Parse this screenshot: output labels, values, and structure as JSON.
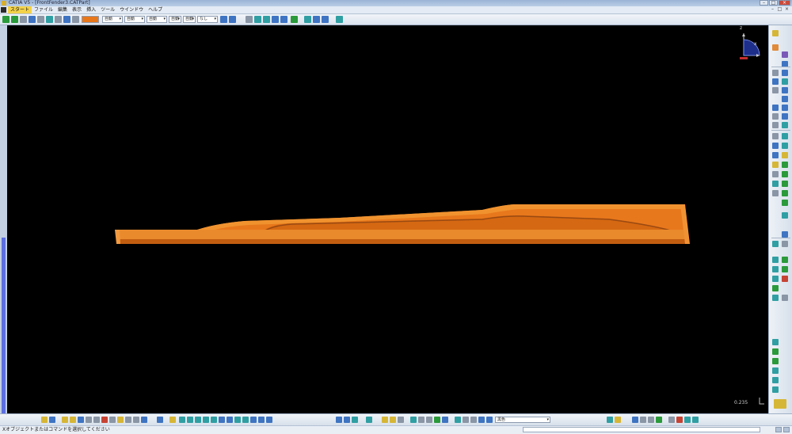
{
  "window": {
    "title": "CATIA V5 - [FrontFender3.CATPart]",
    "minimize_glyph": "–",
    "maximize_glyph": "□",
    "close_glyph": "×"
  },
  "menu": {
    "items": [
      "スタート",
      "ファイル",
      "編集",
      "表示",
      "挿入",
      "ツール",
      "ウインドウ",
      "ヘルプ"
    ],
    "active_index": 0
  },
  "toolbar_top": {
    "color_combo": "",
    "transparency_combo": "自動",
    "line_type_combo": "自動",
    "line_weight_combo": "自動",
    "point_symbol_combo": "自動",
    "layer_combo": "なし",
    "accent_color": "#e8771c"
  },
  "viewport": {
    "background": "#000000",
    "part_color": "#e8781c",
    "compass_axis_z": "z",
    "compass_axis_x": "x",
    "scale_value": "0.235"
  },
  "toolbar_bottom": {
    "render_style_combo": "黒色"
  },
  "statusbar": {
    "message": "Xオブジェクトまたはコマンドを選択してください"
  },
  "icons": {
    "top": [
      "select-arrow-icon",
      "translate-icon",
      "pan-icon",
      "draw-icon",
      "sketch-icon",
      "snap-icon",
      "move-icon",
      "copy-icon",
      "paste-icon",
      "fly-icon",
      "zoom-area-icon",
      "rotate-icon",
      "normal-view-icon",
      "multi-view-icon",
      "analysis-icon",
      "tools-icon"
    ],
    "right": [
      "spline-icon",
      "sketcher-icon",
      "plane-icon",
      "point-icon",
      "line-icon",
      "extrude-icon",
      "revolve-icon",
      "sweep-icon",
      "fill-icon",
      "blend-icon",
      "join-icon",
      "split-icon",
      "trim-icon",
      "fillet-icon",
      "chamfer-icon",
      "translate-icon",
      "rotate-icon",
      "symmetry-icon",
      "scale-icon",
      "offset-icon",
      "extract-icon",
      "boundary-icon",
      "parallel-icon",
      "axis-icon",
      "law-icon",
      "measure-icon",
      "inertia-icon",
      "connect-icon",
      "curvature-icon",
      "distance-icon",
      "draft-analysis-icon",
      "porcupine-icon",
      "cut-plane-icon",
      "reflection-icon",
      "highlight-icon",
      "catia-logo-icon"
    ],
    "bottom": [
      "fit-all-icon",
      "new-icon",
      "open-icon",
      "save-icon",
      "print-icon",
      "cut-icon",
      "copy-icon",
      "paste-icon",
      "undo-icon",
      "redo-icon",
      "search-icon",
      "fly-mode-icon",
      "fit-icon",
      "pan-icon",
      "rotate-icon",
      "zoom-in-icon",
      "zoom-out-icon",
      "normal-icon",
      "iso-view-icon",
      "shading-icon",
      "hide-show-icon",
      "swap-icon",
      "measure-icon",
      "material-icon",
      "sketch-icon",
      "apply-material-icon",
      "render-icon",
      "boundary-icon",
      "measure-between-icon",
      "formula-icon",
      "knowledge-icon",
      "catalog-icon",
      "light-icon",
      "environment-icon",
      "camera-icon",
      "shadow-icon",
      "analysis-icon",
      "dress-up-icon",
      "part-icon",
      "body-icon"
    ]
  }
}
